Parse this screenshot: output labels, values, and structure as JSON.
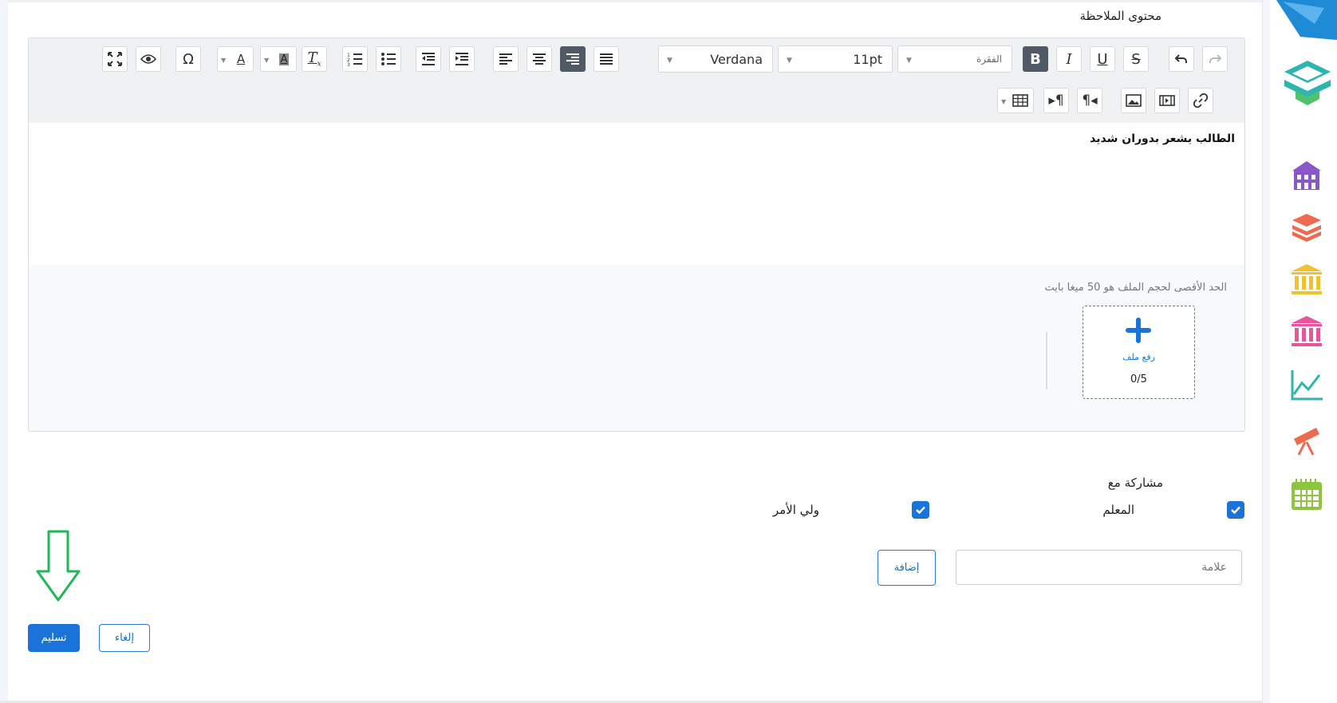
{
  "note": {
    "content_label": "محتوى الملاحظة",
    "body_text": "الطالب يشعر بدوران شديد"
  },
  "toolbar": {
    "font_family": "Verdana",
    "font_size": "11pt",
    "paragraph_format": "الفقرة"
  },
  "upload": {
    "limit_note": "الحد الأقصى لحجم الملف هو 50 ميغا بايت",
    "button_label": "رفع ملف",
    "count": "0/5"
  },
  "share": {
    "label": "مشاركة مع",
    "options": [
      {
        "label": "المعلم",
        "checked": true
      },
      {
        "label": "ولي الأمر",
        "checked": true
      }
    ]
  },
  "tag": {
    "placeholder": "علامة",
    "add_label": "إضافة"
  },
  "actions": {
    "cancel_label": "إلغاء",
    "submit_label": "تسليم"
  },
  "colors": {
    "accent": "#1a73d9",
    "annotation_arrow": "#1db954"
  },
  "sidebar_icons": [
    "logo-icon",
    "layers-logo-icon",
    "school-icon",
    "books-icon",
    "institution-icon",
    "museum-icon",
    "chart-line-icon",
    "telescope-icon",
    "calendar-icon"
  ]
}
